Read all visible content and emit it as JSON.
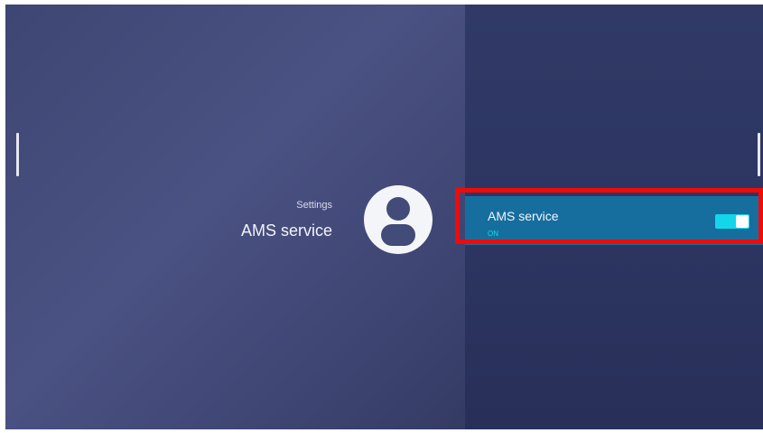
{
  "breadcrumb": "Settings",
  "page_title": "AMS service",
  "avatar_icon": "person-icon",
  "setting": {
    "label": "AMS service",
    "status": "ON",
    "enabled": true
  },
  "colors": {
    "left_pane": "#454d7c",
    "right_pane": "#2e3763",
    "row_background": "#166e9e",
    "accent": "#13d6ea",
    "highlight": "#f00a0a"
  }
}
